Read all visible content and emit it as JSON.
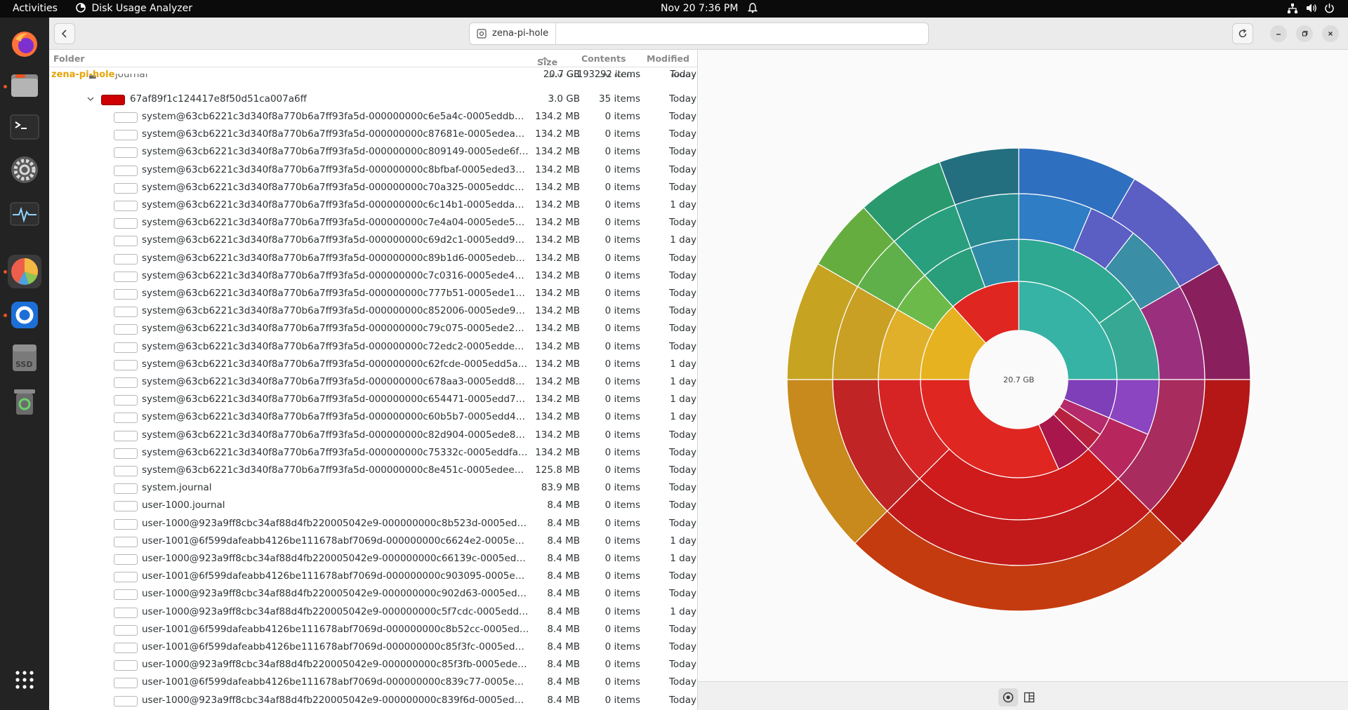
{
  "topbar": {
    "activities": "Activities",
    "app_name": "Disk Usage Analyzer",
    "clock": "Nov 20  7:36 PM"
  },
  "dock": {
    "apps": [
      {
        "name": "firefox-icon",
        "color": "#ff7139"
      },
      {
        "name": "files-icon",
        "color": "#b4b4b4"
      },
      {
        "name": "terminal-icon",
        "color": "#3a3a3a"
      },
      {
        "name": "settings-icon",
        "color": "#9a9a9a"
      },
      {
        "name": "system-monitor-icon",
        "color": "#3a3a3a"
      },
      {
        "name": "disk-usage-analyzer-icon",
        "color": "#ed5f4a"
      },
      {
        "name": "onboard-icon",
        "color": "#1d6fd8"
      },
      {
        "name": "ssd-drive-icon",
        "color": "#7a7a7a",
        "label": "SSD"
      },
      {
        "name": "trash-icon",
        "color": "#5a5a5a"
      },
      {
        "name": "app-grid-icon",
        "color": "#ffffff"
      }
    ]
  },
  "header": {
    "location": "zena-pi-hole"
  },
  "list": {
    "columns": {
      "folder": "Folder",
      "size": "Size",
      "contents": "Contents",
      "modified": "Modified"
    },
    "root": {
      "name": "zena-pi-hole",
      "size": "20.7 GB",
      "contents": "193292 items",
      "modified": "Today"
    },
    "partial": {
      "name": "journal",
      "size": "3.0 GB",
      "contents": "36 items",
      "modified": "Today"
    },
    "folder": {
      "name": "67af89f1c124417e8f50d51ca007a6ff",
      "size": "3.0 GB",
      "contents": "35 items",
      "modified": "Today",
      "color": "#cc0000"
    },
    "files": [
      {
        "name": "system@63cb6221c3d340f8a770b6a7ff93fa5d-000000000c6e5a4c-0005eddbb8e42a6f.journal",
        "size": "134.2 MB",
        "contents": "0 items",
        "modified": "Today"
      },
      {
        "name": "system@63cb6221c3d340f8a770b6a7ff93fa5d-000000000c87681e-0005edead1e7bc65.journal",
        "size": "134.2 MB",
        "contents": "0 items",
        "modified": "Today"
      },
      {
        "name": "system@63cb6221c3d340f8a770b6a7ff93fa5d-000000000c809149-0005ede6fb64e7c0.journal",
        "size": "134.2 MB",
        "contents": "0 items",
        "modified": "Today"
      },
      {
        "name": "system@63cb6221c3d340f8a770b6a7ff93fa5d-000000000c8bfbaf-0005eded399e192c.journal",
        "size": "134.2 MB",
        "contents": "0 items",
        "modified": "Today"
      },
      {
        "name": "system@63cb6221c3d340f8a770b6a7ff93fa5d-000000000c70a325-0005eddcde596e8.journal",
        "size": "134.2 MB",
        "contents": "0 items",
        "modified": "Today"
      },
      {
        "name": "system@63cb6221c3d340f8a770b6a7ff93fa5d-000000000c6c14b1-0005eddac9184c20.journal",
        "size": "134.2 MB",
        "contents": "0 items",
        "modified": "1 day"
      },
      {
        "name": "system@63cb6221c3d340f8a770b6a7ff93fa5d-000000000c7e4a04-0005ede5c51b55e9.journal",
        "size": "134.2 MB",
        "contents": "0 items",
        "modified": "Today"
      },
      {
        "name": "system@63cb6221c3d340f8a770b6a7ff93fa5d-000000000c69d2c1-0005edd9d88a43d.journal",
        "size": "134.2 MB",
        "contents": "0 items",
        "modified": "1 day"
      },
      {
        "name": "system@63cb6221c3d340f8a770b6a7ff93fa5d-000000000c89b1d6-0005edebea90545.journal",
        "size": "134.2 MB",
        "contents": "0 items",
        "modified": "Today"
      },
      {
        "name": "system@63cb6221c3d340f8a770b6a7ff93fa5d-000000000c7c0316-0005ede4506363e4.journal",
        "size": "134.2 MB",
        "contents": "0 items",
        "modified": "Today"
      },
      {
        "name": "system@63cb6221c3d340f8a770b6a7ff93fa5d-000000000c777b51-0005ede1200f178e.journal",
        "size": "134.2 MB",
        "contents": "0 items",
        "modified": "Today"
      },
      {
        "name": "system@63cb6221c3d340f8a770b6a7ff93fa5d-000000000c852006-0005ede9b3c17aa6.journal",
        "size": "134.2 MB",
        "contents": "0 items",
        "modified": "Today"
      },
      {
        "name": "system@63cb6221c3d340f8a770b6a7ff93fa5d-000000000c79c075-0005ede2a9354a22.journal",
        "size": "134.2 MB",
        "contents": "0 items",
        "modified": "Today"
      },
      {
        "name": "system@63cb6221c3d340f8a770b6a7ff93fa5d-000000000c72edc2-0005edde1c70059d.journal",
        "size": "134.2 MB",
        "contents": "0 items",
        "modified": "Today"
      },
      {
        "name": "system@63cb6221c3d340f8a770b6a7ff93fa5d-000000000c62fcde-0005edd5af91f582.journal",
        "size": "134.2 MB",
        "contents": "0 items",
        "modified": "1 day"
      },
      {
        "name": "system@63cb6221c3d340f8a770b6a7ff93fa5d-000000000c678aa3-0005edd874350daf.journal",
        "size": "134.2 MB",
        "contents": "0 items",
        "modified": "1 day"
      },
      {
        "name": "system@63cb6221c3d340f8a770b6a7ff93fa5d-000000000c654471-0005edd71a37365f.journal",
        "size": "134.2 MB",
        "contents": "0 items",
        "modified": "1 day"
      },
      {
        "name": "system@63cb6221c3d340f8a770b6a7ff93fa5d-000000000c60b5b7-0005edd44599d1c.journal",
        "size": "134.2 MB",
        "contents": "0 items",
        "modified": "1 day"
      },
      {
        "name": "system@63cb6221c3d340f8a770b6a7ff93fa5d-000000000c82d904-0005ede844f9b709.journal",
        "size": "134.2 MB",
        "contents": "0 items",
        "modified": "Today"
      },
      {
        "name": "system@63cb6221c3d340f8a770b6a7ff93fa5d-000000000c75332c-0005eddfabddd0b.journal",
        "size": "134.2 MB",
        "contents": "0 items",
        "modified": "Today"
      },
      {
        "name": "system@63cb6221c3d340f8a770b6a7ff93fa5d-000000000c8e451c-0005edee8bf42e0d.journal",
        "size": "125.8 MB",
        "contents": "0 items",
        "modified": "Today"
      },
      {
        "name": "system.journal",
        "size": "83.9 MB",
        "contents": "0 items",
        "modified": "Today"
      },
      {
        "name": "user-1000.journal",
        "size": "8.4 MB",
        "contents": "0 items",
        "modified": "Today"
      },
      {
        "name": "user-1000@923a9ff8cbc34af88d4fb220005042e9-000000000c8b523d-0005edecd451e0.journal",
        "size": "8.4 MB",
        "contents": "0 items",
        "modified": "Today"
      },
      {
        "name": "user-1001@6f599dafeabb4126be111678abf7069d-000000000c6624e2-0005edd7abdd.journal",
        "size": "8.4 MB",
        "contents": "0 items",
        "modified": "1 day"
      },
      {
        "name": "user-1000@923a9ff8cbc34af88d4fb220005042e9-000000000c66139c-0005edd7a42882.journal",
        "size": "8.4 MB",
        "contents": "0 items",
        "modified": "1 day"
      },
      {
        "name": "user-1001@6f599dafeabb4126be111678abf7069d-000000000c903095-0005edefc2ce8.journal",
        "size": "8.4 MB",
        "contents": "0 items",
        "modified": "Today"
      },
      {
        "name": "user-1000@923a9ff8cbc34af88d4fb220005042e9-000000000c902d63-0005edefc25a70.journal",
        "size": "8.4 MB",
        "contents": "0 items",
        "modified": "Today"
      },
      {
        "name": "user-1000@923a9ff8cbc34af88d4fb220005042e9-000000000c5f7cdc-0005edd372b447.journal",
        "size": "8.4 MB",
        "contents": "0 items",
        "modified": "1 day"
      },
      {
        "name": "user-1001@6f599dafeabb4126be111678abf7069d-000000000c8b52cc-0005ede0ed462c.journal",
        "size": "8.4 MB",
        "contents": "0 items",
        "modified": "Today"
      },
      {
        "name": "user-1001@6f599dafeabb4126be111678abf7069d-000000000c85f3fc-0005edea0f7600.journal",
        "size": "8.4 MB",
        "contents": "0 items",
        "modified": "Today"
      },
      {
        "name": "user-1000@923a9ff8cbc34af88d4fb220005042e9-000000000c85f3fb-0005edea0f7588.journal",
        "size": "8.4 MB",
        "contents": "0 items",
        "modified": "Today"
      },
      {
        "name": "user-1001@6f599dafeabb4126be111678abf7069d-000000000c839c77-0005ede8c5391.journal",
        "size": "8.4 MB",
        "contents": "0 items",
        "modified": "Today"
      },
      {
        "name": "user-1000@923a9ff8cbc34af88d4fb220005042e9-000000000c839f6d-0005ede8c84430.journal",
        "size": "8.4 MB",
        "contents": "0 items",
        "modified": "Today"
      }
    ]
  },
  "chart": {
    "center_label": "20.7 GB",
    "view_modes": {
      "rings": "rings-chart-icon",
      "treemap": "treemap-chart-icon"
    }
  },
  "chart_data": {
    "type": "sunburst",
    "total": "20.7 GB",
    "rings": [
      [
        {
          "start": 0,
          "end": 90,
          "color": "#36b3a4"
        },
        {
          "start": 90,
          "end": 113,
          "color": "#7e3fb8"
        },
        {
          "start": 113,
          "end": 124,
          "color": "#b42a6a"
        },
        {
          "start": 124,
          "end": 135,
          "color": "#b8213d"
        },
        {
          "start": 135,
          "end": 156,
          "color": "#a8164b"
        },
        {
          "start": 156,
          "end": 270,
          "color": "#e02620"
        },
        {
          "start": 270,
          "end": 318,
          "color": "#e6b21f"
        },
        {
          "start": 318,
          "end": 360,
          "color": "#e02620"
        }
      ],
      [
        {
          "start": 0,
          "end": 55,
          "color": "#2fa892"
        },
        {
          "start": 55,
          "end": 90,
          "color": "#37a893"
        },
        {
          "start": 90,
          "end": 113,
          "color": "#8b45c0"
        },
        {
          "start": 113,
          "end": 135,
          "color": "#b7275d"
        },
        {
          "start": 135,
          "end": 225,
          "color": "#cf1b1b"
        },
        {
          "start": 225,
          "end": 270,
          "color": "#d62424"
        },
        {
          "start": 270,
          "end": 300,
          "color": "#e0b02a"
        },
        {
          "start": 300,
          "end": 318,
          "color": "#6cbb4a"
        },
        {
          "start": 318,
          "end": 340,
          "color": "#2a9e7a"
        },
        {
          "start": 340,
          "end": 360,
          "color": "#2f8aa8"
        }
      ],
      [
        {
          "start": 0,
          "end": 23,
          "color": "#2f7dc4"
        },
        {
          "start": 23,
          "end": 38,
          "color": "#5b5ec2"
        },
        {
          "start": 38,
          "end": 60,
          "color": "#3a8ea5"
        },
        {
          "start": 60,
          "end": 90,
          "color": "#9a2f7e"
        },
        {
          "start": 90,
          "end": 135,
          "color": "#a82d5e"
        },
        {
          "start": 135,
          "end": 225,
          "color": "#c21a1a"
        },
        {
          "start": 225,
          "end": 270,
          "color": "#c02424"
        },
        {
          "start": 270,
          "end": 300,
          "color": "#c9a024"
        },
        {
          "start": 300,
          "end": 318,
          "color": "#5fb04a"
        },
        {
          "start": 318,
          "end": 340,
          "color": "#2a9f7e"
        },
        {
          "start": 340,
          "end": 360,
          "color": "#268a8e"
        }
      ],
      [
        {
          "start": 0,
          "end": 30,
          "color": "#2f6fc0"
        },
        {
          "start": 30,
          "end": 60,
          "color": "#5b5ec2"
        },
        {
          "start": 60,
          "end": 90,
          "color": "#8a1f5e"
        },
        {
          "start": 90,
          "end": 135,
          "color": "#b51717"
        },
        {
          "start": 135,
          "end": 225,
          "color": "#c43b0f"
        },
        {
          "start": 225,
          "end": 270,
          "color": "#c88a1d"
        },
        {
          "start": 270,
          "end": 300,
          "color": "#c7a322"
        },
        {
          "start": 300,
          "end": 318,
          "color": "#66ad3f"
        },
        {
          "start": 318,
          "end": 340,
          "color": "#2a9a6e"
        },
        {
          "start": 340,
          "end": 360,
          "color": "#236f7f"
        }
      ]
    ]
  }
}
